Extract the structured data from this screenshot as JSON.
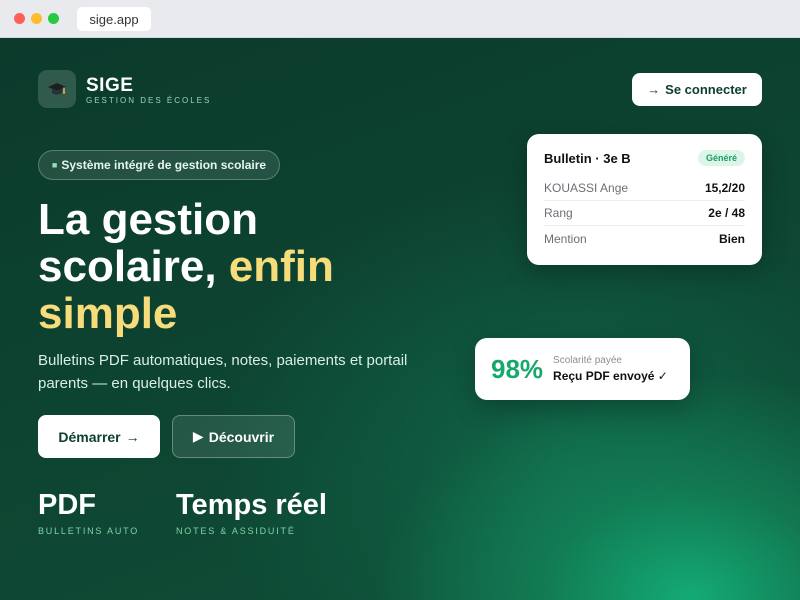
{
  "browser": {
    "url": "sige.app"
  },
  "brand": {
    "name": "SIGE",
    "tagline": "GESTION DES ÉCOLES",
    "logo_icon": "graduation-cap-icon"
  },
  "header": {
    "connect_label": "Se connecter",
    "connect_arrow": "→"
  },
  "hero": {
    "pill": "Système intégré de gestion scolaire",
    "headline_line1": "La gestion",
    "headline_line2_a": "scolaire, ",
    "headline_line2_b": "enfin",
    "headline_line3": "simple",
    "subtitle": "Bulletins PDF automatiques, notes, paiements et portail parents — en quelques clics.",
    "start_label": "Démarrer",
    "start_arrow": "→",
    "discover_icon": "▶",
    "discover_label": "Découvrir"
  },
  "stats": [
    {
      "value": "PDF",
      "label": "BULLETINS AUTO"
    },
    {
      "value": "Temps réel",
      "label": "NOTES & ASSIDUITÉ"
    }
  ],
  "bulletin_card": {
    "title": "Bulletin · 3e B",
    "badge": "Généré",
    "rows": [
      {
        "key": "KOUASSI Ange",
        "value": "15,2/20"
      },
      {
        "key": "Rang",
        "value": "2e / 48"
      },
      {
        "key": "Mention",
        "value": "Bien"
      }
    ]
  },
  "payment_card": {
    "percent": "98%",
    "label": "Scolarité payée",
    "status": "Reçu PDF envoyé ✓"
  },
  "colors": {
    "accent_yellow": "#f6dc7a",
    "brand_green": "#17a86c",
    "dark_green": "#0d3f2e"
  }
}
